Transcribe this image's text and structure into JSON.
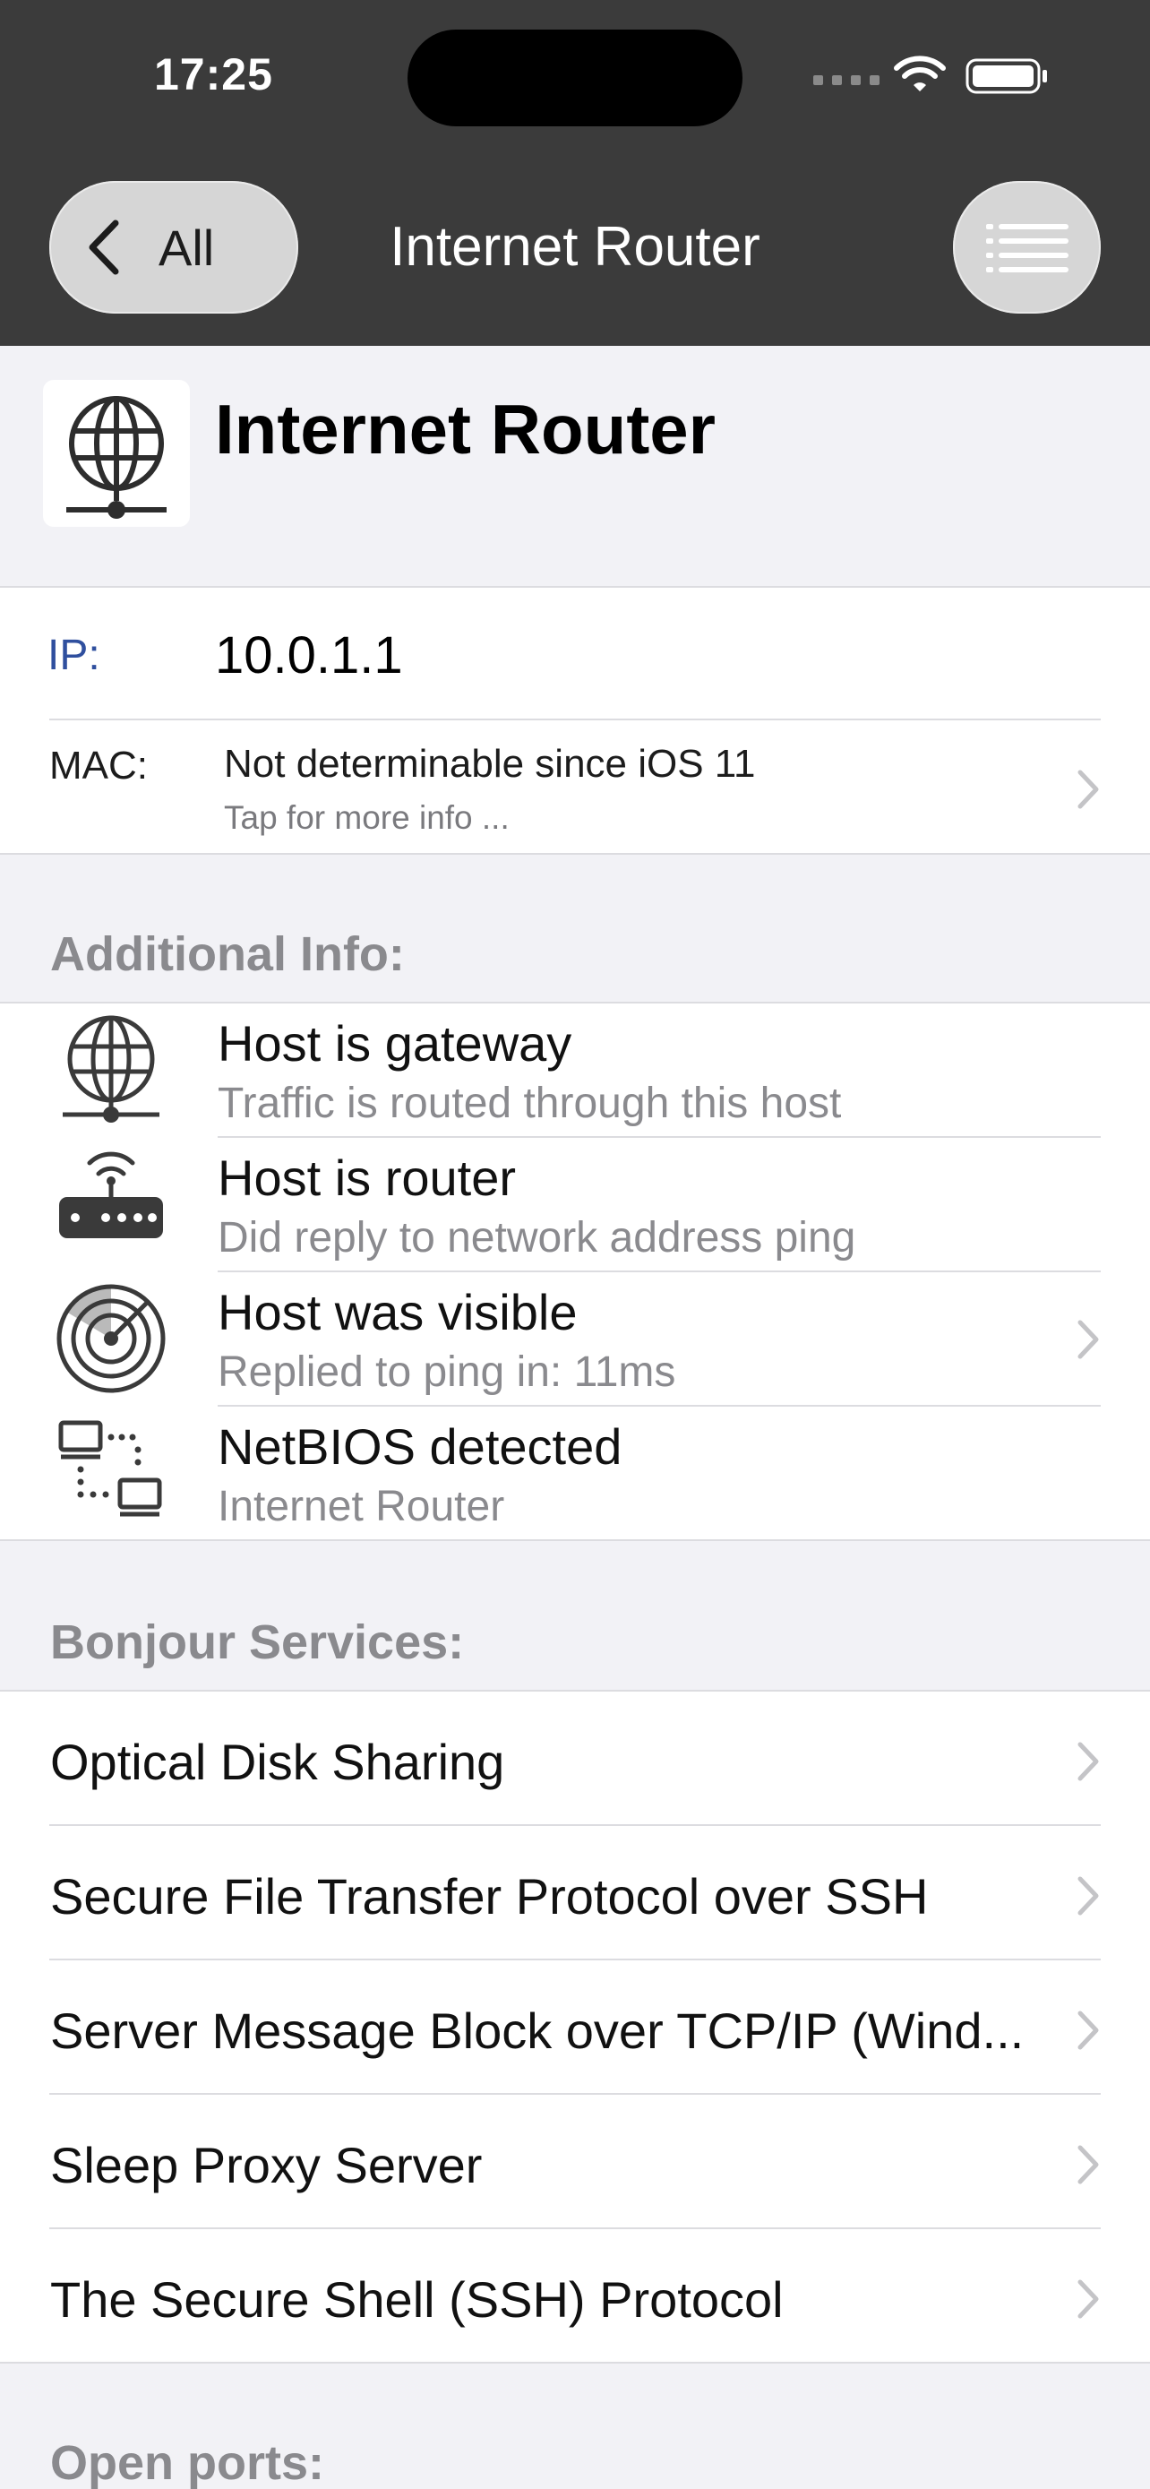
{
  "status_bar": {
    "time": "17:25"
  },
  "nav": {
    "back_label": "All",
    "title": "Internet Router"
  },
  "device": {
    "name": "Internet Router"
  },
  "addresses": {
    "ip_label": "IP:",
    "ip_value": "10.0.1.1",
    "mac_label": "MAC:",
    "mac_value": "Not determinable since iOS 11",
    "mac_hint": "Tap for more info ..."
  },
  "additional_info": {
    "header": "Additional Info:",
    "items": [
      {
        "icon": "globe-network-icon",
        "title": "Host is gateway",
        "subtitle": "Traffic is routed through this host"
      },
      {
        "icon": "router-icon",
        "title": "Host is router",
        "subtitle": "Did reply to network address ping"
      },
      {
        "icon": "radar-icon",
        "title": "Host was visible",
        "subtitle": "Replied to ping in: 11ms"
      },
      {
        "icon": "network-computers-icon",
        "title": "NetBIOS detected",
        "subtitle": "Internet Router"
      }
    ]
  },
  "bonjour": {
    "header": "Bonjour Services:",
    "items": [
      "Optical Disk Sharing",
      "Secure File Transfer Protocol over SSH",
      "Server Message Block over TCP/IP (Wind...",
      "Sleep Proxy Server",
      "The Secure Shell (SSH) Protocol"
    ]
  },
  "open_ports": {
    "header": "Open ports:"
  },
  "colors": {
    "header_bg": "#3b3b3b",
    "page_bg": "#f2f2f6",
    "ip_label": "#2f4f9e",
    "secondary_text": "#8a8a8e"
  }
}
